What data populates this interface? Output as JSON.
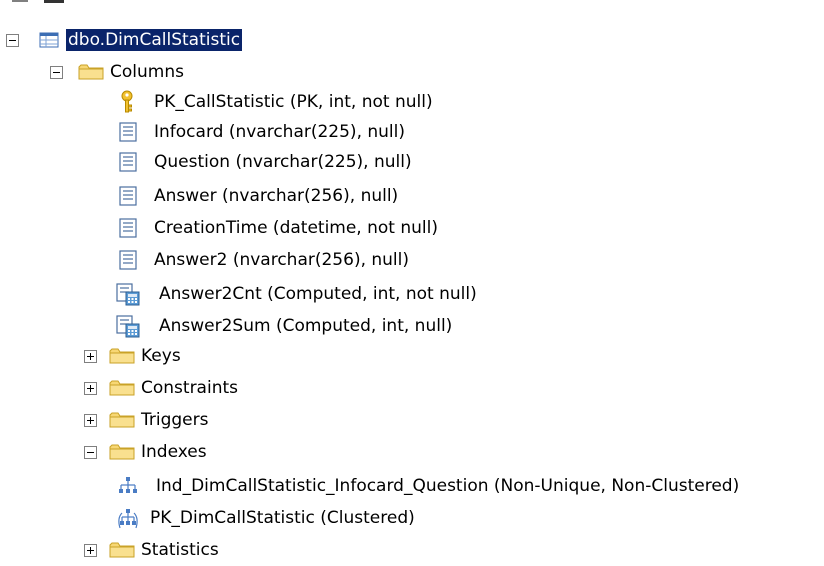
{
  "table": {
    "label": "dbo.DimCallStatistic"
  },
  "folders": {
    "columns": "Columns",
    "keys": "Keys",
    "constraints": "Constraints",
    "triggers": "Triggers",
    "indexes": "Indexes",
    "statistics": "Statistics"
  },
  "columns": [
    {
      "label": "PK_CallStatistic (PK, int, not null)",
      "icon": "key-icon"
    },
    {
      "label": "Infocard (nvarchar(225), null)",
      "icon": "column-icon"
    },
    {
      "label": "Question (nvarchar(225), null)",
      "icon": "column-icon"
    },
    {
      "label": "Answer (nvarchar(256), null)",
      "icon": "column-icon"
    },
    {
      "label": "CreationTime (datetime, not null)",
      "icon": "column-icon"
    },
    {
      "label": "Answer2 (nvarchar(256), null)",
      "icon": "column-icon"
    },
    {
      "label": "Answer2Cnt (Computed, int, not null)",
      "icon": "computed-column-icon"
    },
    {
      "label": "Answer2Sum (Computed, int, null)",
      "icon": "computed-column-icon"
    }
  ],
  "indexes": [
    {
      "label": "Ind_DimCallStatistic_Infocard_Question (Non-Unique, Non-Clustered)",
      "icon": "nonclustered-index-icon"
    },
    {
      "label": "PK_DimCallStatistic (Clustered)",
      "icon": "clustered-index-icon"
    }
  ],
  "colors": {
    "selection": "#0a246a",
    "folder": "#f7d774"
  }
}
